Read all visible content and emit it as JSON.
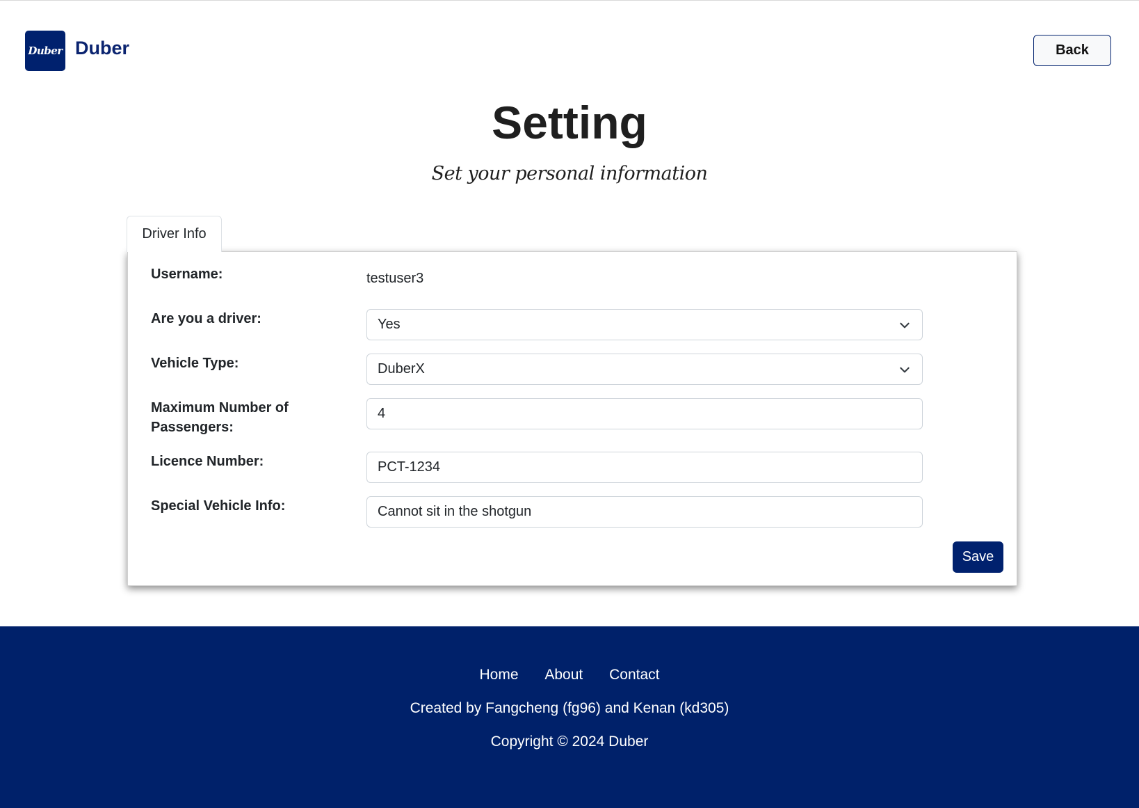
{
  "header": {
    "logo_text": "Duber",
    "brand": "Duber",
    "back_label": "Back"
  },
  "page": {
    "title": "Setting",
    "subtitle": "Set your personal information"
  },
  "tabs": [
    {
      "label": "Driver Info",
      "active": true
    }
  ],
  "form": {
    "username": {
      "label": "Username:",
      "value": "testuser3"
    },
    "is_driver": {
      "label": "Are you a driver:",
      "value": "Yes"
    },
    "vehicle_type": {
      "label": "Vehicle Type:",
      "value": "DuberX"
    },
    "max_passengers": {
      "label": "Maximum Number of Passengers:",
      "value": "4"
    },
    "licence": {
      "label": "Licence Number:",
      "value": "PCT-1234"
    },
    "special_info": {
      "label": "Special Vehicle Info:",
      "value": "Cannot sit in the shotgun"
    },
    "save_label": "Save"
  },
  "footer": {
    "links": [
      "Home",
      "About",
      "Contact"
    ],
    "credit": "Created by Fangcheng (fg96) and Kenan (kd305)",
    "copyright": "Copyright © 2024 Duber"
  },
  "colors": {
    "brand": "#00216e",
    "footer_bg": "#00216a"
  }
}
